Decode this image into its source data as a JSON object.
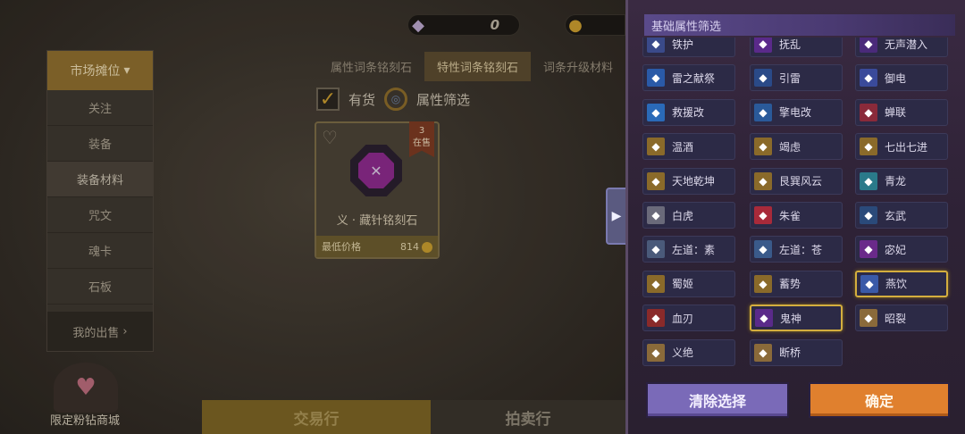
{
  "currency": {
    "gems": "0",
    "gem_icon": "diamond-icon",
    "coin_icon": "coin-icon"
  },
  "side_menu": {
    "header": "市场摊位",
    "items": [
      "关注",
      "装备",
      "装备材料",
      "咒文",
      "魂卡",
      "石板"
    ],
    "active_index": 2,
    "footer": "我的出售"
  },
  "tabs": [
    "属性词条铭刻石",
    "特性词条铭刻石",
    "词条升级材料"
  ],
  "active_tab": 1,
  "filters": {
    "in_stock": "有货",
    "attr_filter": "属性筛选"
  },
  "item": {
    "name": "义 · 藏针铭刻石",
    "stock_count": "3",
    "stock_label": "在售",
    "price_label": "最低价格",
    "price": "814"
  },
  "shop": {
    "label": "限定粉钻商城"
  },
  "bottom_nav": {
    "trade": "交易行",
    "auction": "拍卖行"
  },
  "panel": {
    "title": "基础属性筛选",
    "attributes": [
      {
        "label": "铁护",
        "icon": "shield-icon",
        "color": "#3a4a8a",
        "selected": false
      },
      {
        "label": "抚乱",
        "icon": "chaos-icon",
        "color": "#5a2a8a",
        "selected": false
      },
      {
        "label": "无声潜入",
        "icon": "stealth-icon",
        "color": "#4a2a7a",
        "selected": false
      },
      {
        "label": "雷之献祭",
        "icon": "lightning-icon",
        "color": "#2a5aa8",
        "selected": false
      },
      {
        "label": "引雷",
        "icon": "thunder-icon",
        "color": "#2a4a88",
        "selected": false
      },
      {
        "label": "御电",
        "icon": "electric-icon",
        "color": "#3a4a9a",
        "selected": false
      },
      {
        "label": "救援改",
        "icon": "rescue-icon",
        "color": "#2a6ab8",
        "selected": false
      },
      {
        "label": "擎电改",
        "icon": "bolt-icon",
        "color": "#2a5a9a",
        "selected": false
      },
      {
        "label": "蝉联",
        "icon": "chain-icon",
        "color": "#8a2a3a",
        "selected": false
      },
      {
        "label": "温酒",
        "icon": "wine-icon",
        "color": "#8a6a2a",
        "selected": false
      },
      {
        "label": "竭虑",
        "icon": "mind-icon",
        "color": "#8a6a2a",
        "selected": false
      },
      {
        "label": "七出七进",
        "icon": "seven-icon",
        "color": "#8a6a2a",
        "selected": false
      },
      {
        "label": "天地乾坤",
        "icon": "heaven-icon",
        "color": "#8a6a2a",
        "selected": false
      },
      {
        "label": "艮巽风云",
        "icon": "wind-icon",
        "color": "#8a6a2a",
        "selected": false
      },
      {
        "label": "青龙",
        "icon": "dragon-icon",
        "color": "#2a7a8a",
        "selected": false
      },
      {
        "label": "白虎",
        "icon": "tiger-icon",
        "color": "#6a6a7a",
        "selected": false
      },
      {
        "label": "朱雀",
        "icon": "phoenix-icon",
        "color": "#a82a3a",
        "selected": false
      },
      {
        "label": "玄武",
        "icon": "tortoise-icon",
        "color": "#2a4a7a",
        "selected": false
      },
      {
        "label": "左道：素",
        "icon": "path-icon",
        "color": "#4a5a7a",
        "selected": false
      },
      {
        "label": "左道：苍",
        "icon": "path-icon",
        "color": "#3a5a8a",
        "selected": false
      },
      {
        "label": "宓妃",
        "icon": "goddess-icon",
        "color": "#6a2a8a",
        "selected": false
      },
      {
        "label": "蜀姬",
        "icon": "lady-icon",
        "color": "#8a6a2a",
        "selected": false
      },
      {
        "label": "蓄势",
        "icon": "charge-icon",
        "color": "#8a6a2a",
        "selected": false
      },
      {
        "label": "燕饮",
        "icon": "swallow-icon",
        "color": "#3a5aa8",
        "selected": true
      },
      {
        "label": "血刃",
        "icon": "blade-icon",
        "color": "#8a2a2a",
        "selected": false
      },
      {
        "label": "鬼神",
        "icon": "ghost-icon",
        "color": "#5a2a8a",
        "selected": true
      },
      {
        "label": "昭裂",
        "icon": "rift-icon",
        "color": "#8a6a3a",
        "selected": false
      },
      {
        "label": "义绝",
        "icon": "oath-icon",
        "color": "#8a6a3a",
        "selected": false
      },
      {
        "label": "断桥",
        "icon": "bridge-icon",
        "color": "#8a6a3a",
        "selected": false
      }
    ],
    "clear_label": "清除选择",
    "confirm_label": "确定"
  }
}
